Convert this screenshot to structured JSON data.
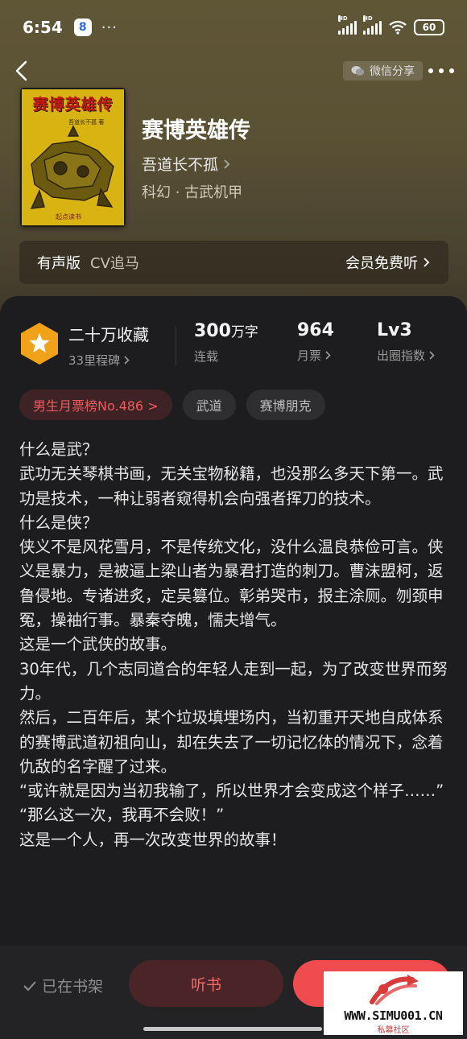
{
  "status": {
    "time": "6:54",
    "app_icon_text": "8",
    "dots": "···",
    "battery": "60"
  },
  "header": {
    "share_label": "微信分享"
  },
  "book": {
    "cover_title": "赛博英雄传",
    "cover_author": "吾道长不孤 著",
    "cover_publisher": "起点读书",
    "title": "赛博英雄传",
    "author": "吾道长不孤",
    "genre": "科幻 · 古武机甲"
  },
  "audio": {
    "label": "有声版",
    "cv": "CV追马",
    "vip": "会员免费听"
  },
  "stats": {
    "collect_main": "二十万收藏",
    "collect_sub": "33里程碑",
    "words_num": "300",
    "words_unit": "万字",
    "words_sub": "连载",
    "ticket_num": "964",
    "ticket_sub": "月票",
    "level_num": "Lv3",
    "level_sub": "出圈指数"
  },
  "tags": [
    "男生月票榜No.486 >",
    "武道",
    "赛博朋克"
  ],
  "description": "什么是武？\n武功无关琴棋书画，无关宝物秘籍，也没那么多天下第一。武功是技术，一种让弱者窥得机会向强者挥刀的技术。\n什么是侠？\n侠义不是风花雪月，不是传统文化，没什么温良恭俭可言。侠义是暴力，是被逼上梁山者为暴君打造的刺刀。曹沫盟柯，返鲁侵地。专诸进炙，定吴篡位。彰弟哭市，报主涂厕。刎颈申冤，操袖行事。暴秦夺魄，懦夫增气。\n这是一个武侠的故事。\n30年代，几个志同道合的年轻人走到一起，为了改变世界而努力。\n然后，二百年后，某个垃圾填埋场内，当初重开天地自成体系的赛博武道初祖向山，却在失去了一切记忆体的情况下，念着仇敌的名字醒了过来。\n“或许就是因为当初我输了，所以世界才会变成这个样子……”\n“那么这一次，我再不会败！”\n这是一个人，再一次改变世界的故事！",
  "bottom": {
    "shelf_label": "已在书架",
    "listen_label": "听书"
  },
  "watermark": {
    "url": "WWW.SIMU001.CN",
    "sub": "私募社区"
  }
}
